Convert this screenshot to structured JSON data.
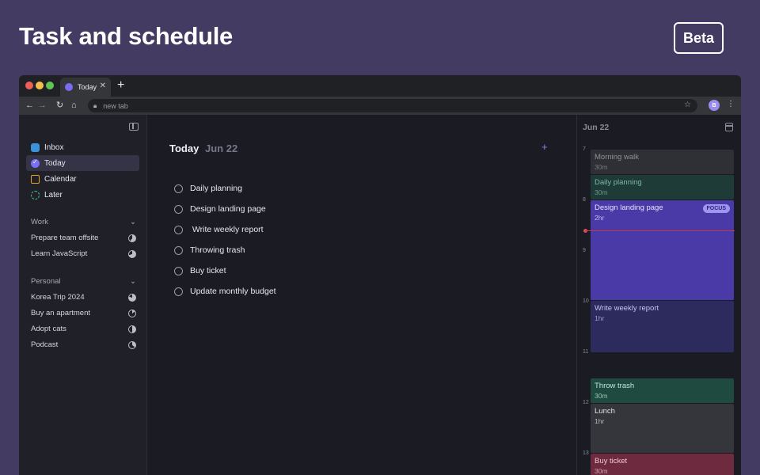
{
  "hero": {
    "title": "Task and schedule",
    "badge": "Beta"
  },
  "browser": {
    "tab_title": "Today",
    "tab_close": "✕",
    "new_tab": "+",
    "url_placeholder": "new tab",
    "profile_initial": "B",
    "icons": [
      "back-arrow-icon",
      "forward-arrow-icon",
      "reload-icon",
      "home-icon",
      "lock-icon",
      "star-icon",
      "kebab-menu-icon"
    ]
  },
  "sidebar": {
    "nav": [
      {
        "label": "Inbox",
        "icon": "inbox-icon"
      },
      {
        "label": "Today",
        "icon": "check-circle-icon"
      },
      {
        "label": "Calendar",
        "icon": "calendar-icon"
      },
      {
        "label": "Later",
        "icon": "dashed-circle-icon"
      }
    ],
    "work": {
      "title": "Work",
      "projects": [
        {
          "label": "Prepare team offsite",
          "progress": 0.6
        },
        {
          "label": "Learn JavaScript",
          "progress": 0.7
        }
      ]
    },
    "personal": {
      "title": "Personal",
      "projects": [
        {
          "label": "Korea Trip 2024",
          "progress": 0.8
        },
        {
          "label": "Buy an apartment",
          "progress": 0.15
        },
        {
          "label": "Adopt cats",
          "progress": 0.5
        },
        {
          "label": "Podcast",
          "progress": 0.35
        }
      ]
    }
  },
  "main": {
    "title": "Today",
    "date": "Jun 22",
    "add": "+",
    "tasks": [
      "Daily planning",
      "Design landing page",
      " Write weekly report",
      "Throwing trash",
      "Buy ticket",
      "Update monthly budget"
    ]
  },
  "calendar": {
    "date": "Jun 22",
    "hours": [
      "7",
      "8",
      "9",
      "10",
      "11",
      "12",
      "13"
    ],
    "events": [
      {
        "title": "Morning walk",
        "duration": "30m",
        "color": "#2f2f36",
        "text_color": "#8f8f9a"
      },
      {
        "title": "Daily planning",
        "duration": "30m",
        "color": "#1f3b38",
        "text_color": "#7fb7a8"
      },
      {
        "title": "Design landing page",
        "duration": "2hr",
        "color": "#4a3aa8",
        "text_color": "#e6e2ff",
        "badge": "FOCUS"
      },
      {
        "title": "Write weekly report",
        "duration": "1hr",
        "color": "#2d2a5e",
        "text_color": "#c7c2f0"
      },
      {
        "title": "Throw trash",
        "duration": "30m",
        "color": "#1f4a40",
        "text_color": "#bfe8d8"
      },
      {
        "title": "Lunch",
        "duration": "1hr",
        "color": "#35353c",
        "text_color": "#e0e0e6"
      },
      {
        "title": "Buy ticket",
        "duration": "30m",
        "color": "#6e2a3e",
        "text_color": "#f2c7d2"
      }
    ]
  }
}
